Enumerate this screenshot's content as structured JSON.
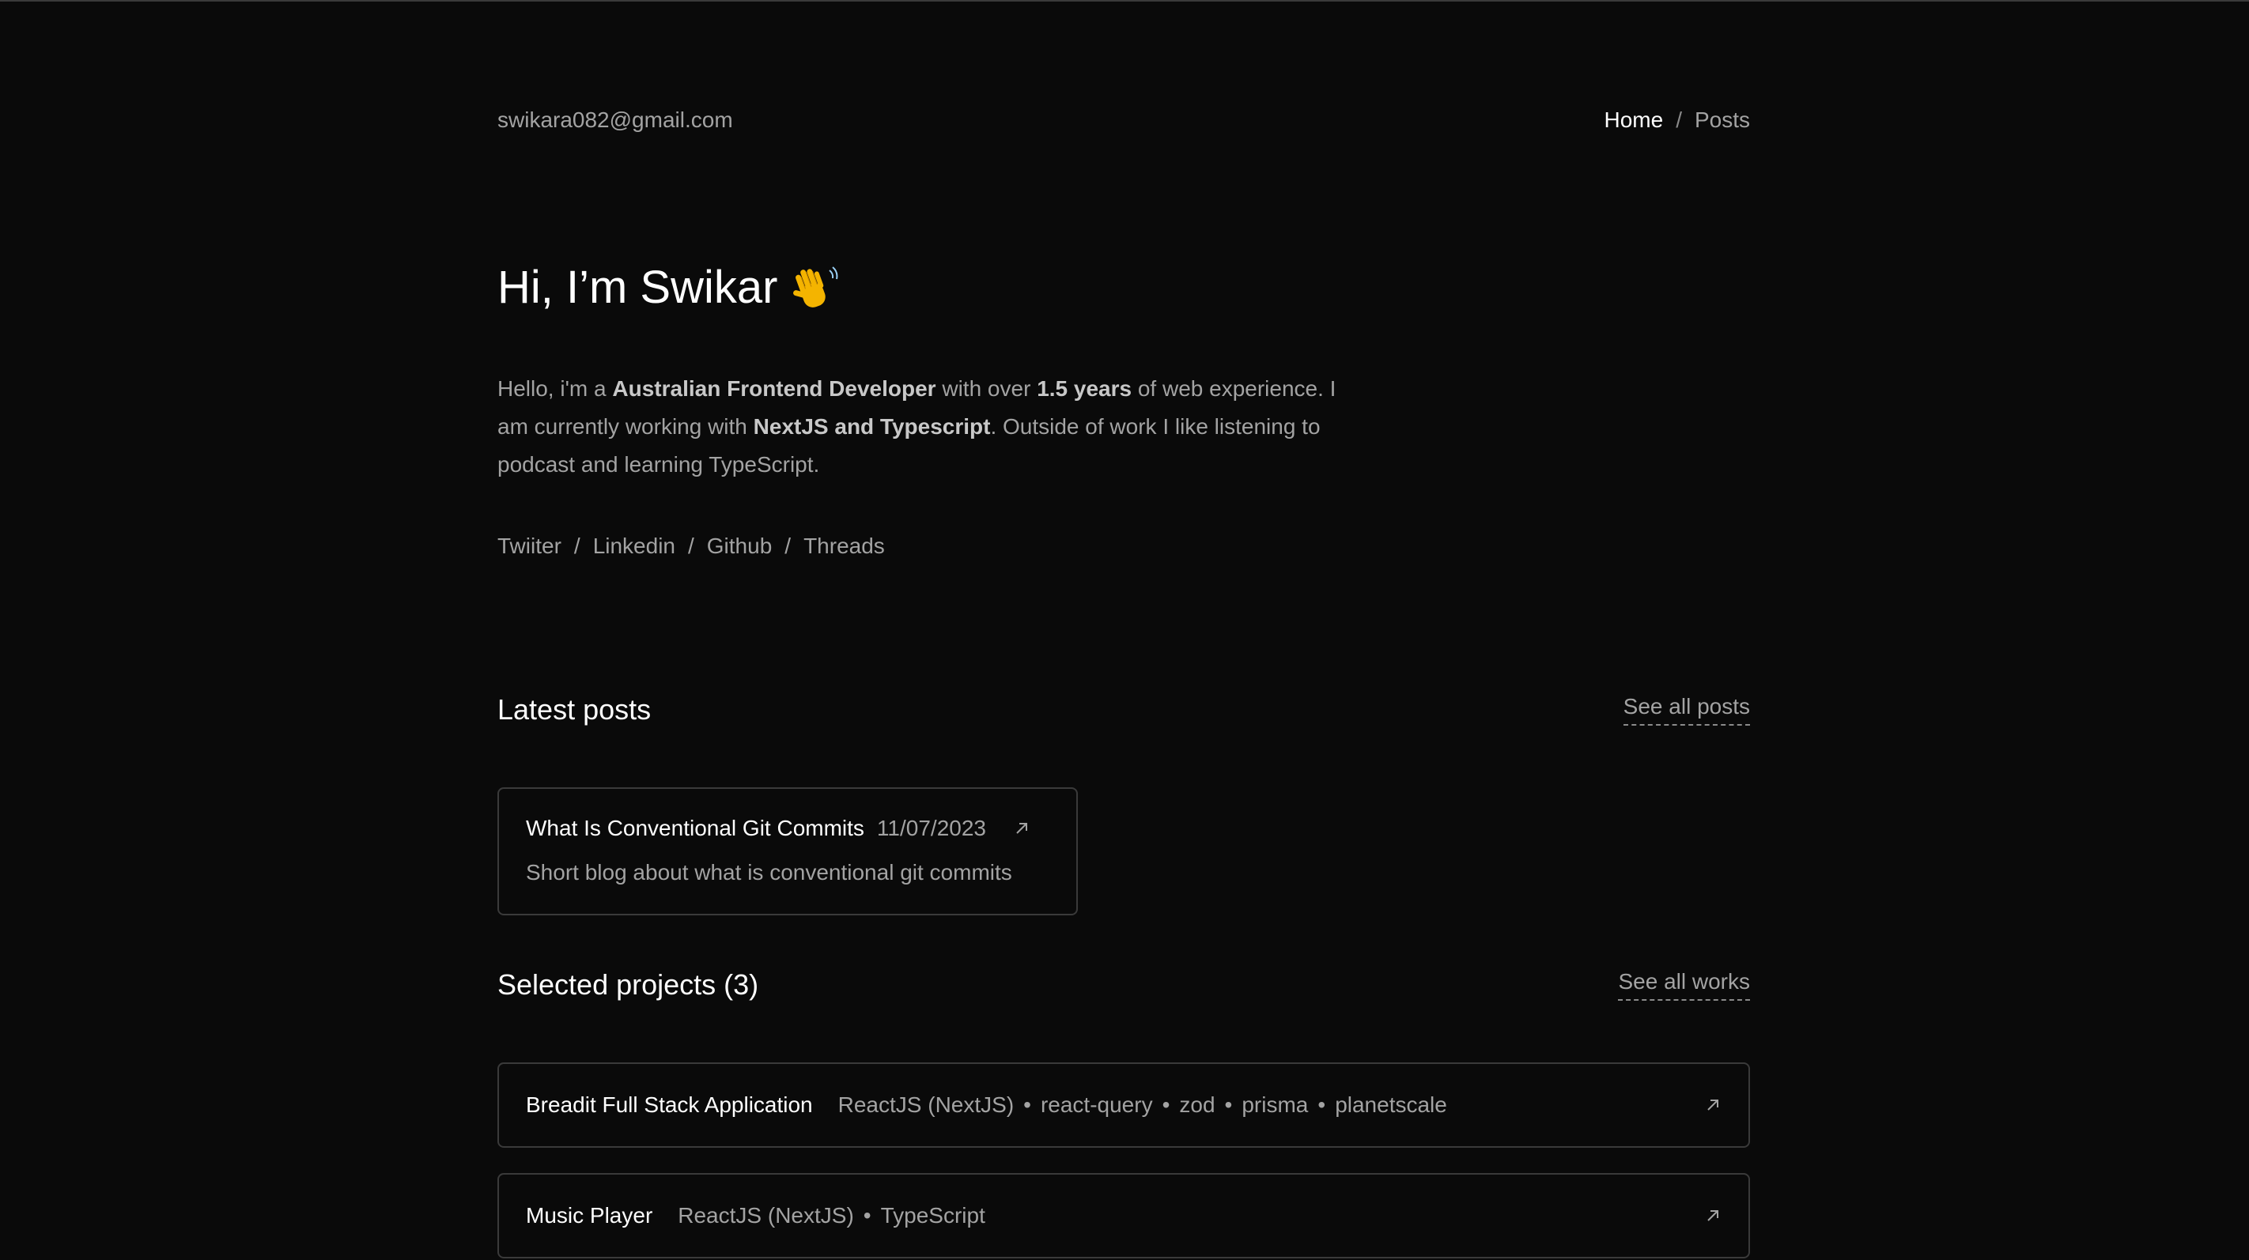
{
  "header": {
    "email": "swikara082@gmail.com",
    "nav": {
      "home": "Home",
      "separator": "/",
      "posts": "Posts"
    }
  },
  "hero": {
    "title": "Hi, I’m Swikar",
    "emoji_icon": "waving-hand-icon",
    "bio": {
      "t1": "Hello, i'm a ",
      "b1": "Australian Frontend Developer",
      "t2": " with over ",
      "b2": "1.5 years",
      "t3": " of web experience. I am currently working with ",
      "b3": "NextJS and Typescript",
      "t4": ". Outside of work I like listening to podcast and learning TypeScript."
    }
  },
  "socials": {
    "separator": "/",
    "links": [
      "Twiiter",
      "Linkedin",
      "Github",
      "Threads"
    ]
  },
  "latest_posts": {
    "title": "Latest posts",
    "see_all": "See all posts",
    "posts": [
      {
        "title": "What Is Conventional Git Commits",
        "date": "11/07/2023",
        "description": "Short blog about what is conventional git commits"
      }
    ]
  },
  "projects": {
    "title": "Selected projects (3)",
    "see_all": "See all works",
    "items": [
      {
        "name": "Breadit Full Stack Application",
        "tags": [
          "ReactJS (NextJS)",
          "react-query",
          "zod",
          "prisma",
          "planetscale"
        ]
      },
      {
        "name": "Music Player",
        "tags": [
          "ReactJS (NextJS)",
          "TypeScript"
        ]
      }
    ],
    "tag_separator": "•"
  },
  "colors": {
    "background": "#0a0a0a",
    "text_primary": "#ffffff",
    "text_muted": "#a3a3a3",
    "border": "#3a3a3a"
  }
}
